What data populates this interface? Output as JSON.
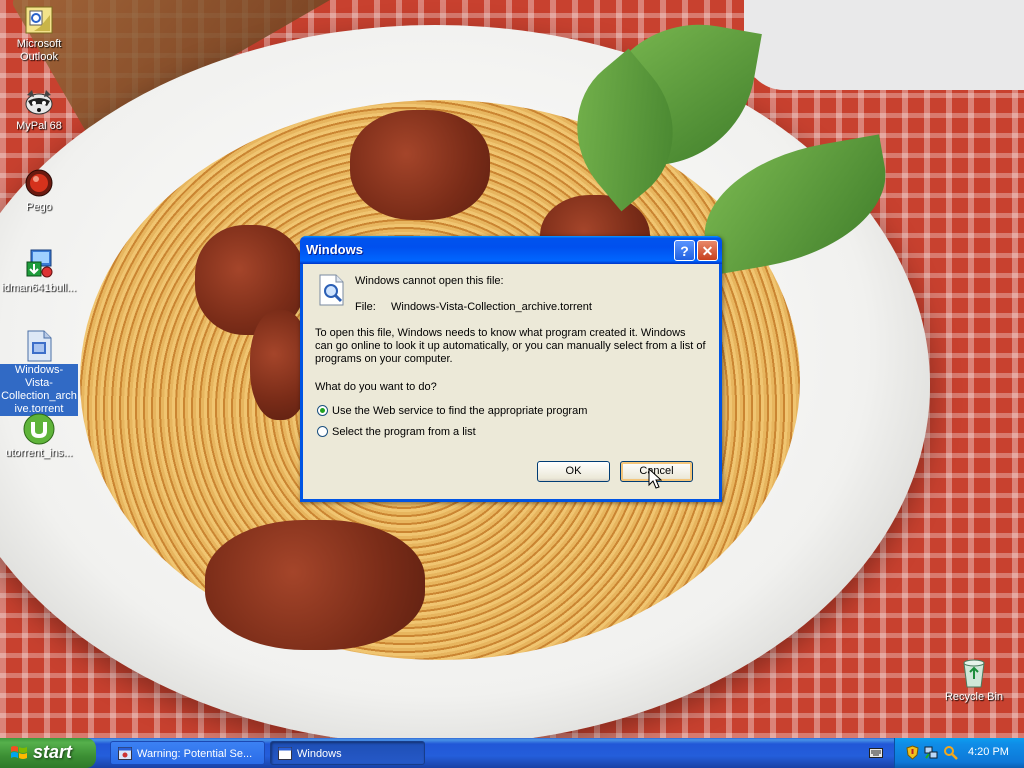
{
  "desktop": {
    "icons": [
      {
        "label": "Microsoft Outlook",
        "icon": "outlook-icon",
        "selected": false
      },
      {
        "label": "MyPal 68",
        "icon": "raccoon-icon",
        "selected": false
      },
      {
        "label": "Pego",
        "icon": "pego-icon",
        "selected": false
      },
      {
        "label": "idman641bull...",
        "icon": "idm-installer-icon",
        "selected": false
      },
      {
        "label": "Windows-Vista-Collection_archive.torrent",
        "label_lines": [
          "Windows-Vista-",
          "Collection_arch",
          "ive.torrent"
        ],
        "icon": "torrent-file-icon",
        "selected": true
      },
      {
        "label": "utorrent_ins...",
        "icon": "utorrent-icon",
        "selected": false
      },
      {
        "label": "Recycle Bin",
        "icon": "recycle-bin-icon",
        "selected": false
      }
    ]
  },
  "dialog": {
    "title": "Windows",
    "message": "Windows cannot open this file:",
    "file_label": "File:",
    "file_name": "Windows-Vista-Collection_archive.torrent",
    "explanation_lines": [
      "To open this file, Windows needs to know what program created it.  Windows",
      "can go online to look it up automatically, or you can manually select from a list of",
      "programs on your computer."
    ],
    "question": "What do you want to do?",
    "options": [
      {
        "label": "Use the Web service to find the appropriate program",
        "selected": true
      },
      {
        "label": "Select the program from a list",
        "selected": false
      }
    ],
    "ok_label": "OK",
    "cancel_label": "Cancel"
  },
  "taskbar": {
    "start_label": "start",
    "tasks": [
      {
        "label": "Warning: Potential Se...",
        "active": false
      },
      {
        "label": "Windows",
        "active": true
      }
    ],
    "clock": "4:20 PM"
  },
  "colors": {
    "titlebar": "#0054e3",
    "taskbar": "#245edb",
    "start_button": "#3c8f34",
    "dialog_bg": "#ece9d8",
    "selection": "#316ac5"
  }
}
